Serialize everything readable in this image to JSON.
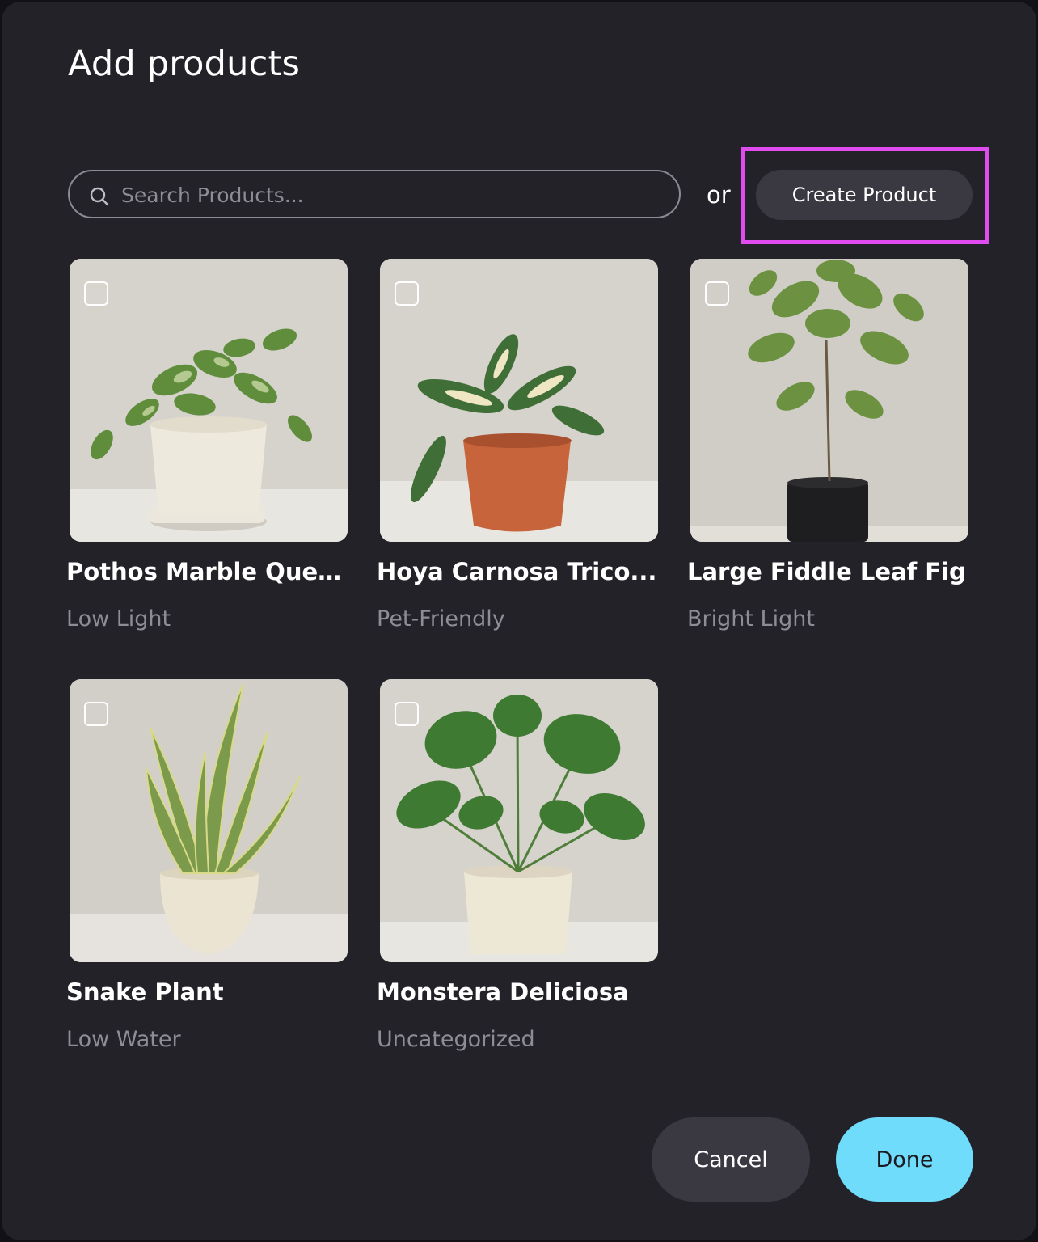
{
  "modal": {
    "title": "Add products"
  },
  "search": {
    "placeholder": "Search Products...",
    "value": "",
    "icon": "search-icon"
  },
  "or_label": "or",
  "create_product_label": "Create Product",
  "colors": {
    "modal_bg": "#232229",
    "highlight": "#e14cf0",
    "done_bg": "#6fdcfb",
    "secondary_button_bg": "#3a3941",
    "muted_text": "#8e8d96"
  },
  "products": [
    {
      "name": "Pothos Marble Queen",
      "category": "Low Light",
      "checked": false,
      "image": "pothos-plant-image"
    },
    {
      "name": "Hoya Carnosa Trico...",
      "category": "Pet-Friendly",
      "checked": false,
      "image": "hoya-plant-image"
    },
    {
      "name": "Large Fiddle Leaf Fig",
      "category": "Bright Light",
      "checked": false,
      "image": "fiddle-leaf-fig-image"
    },
    {
      "name": "Snake Plant",
      "category": "Low Water",
      "checked": false,
      "image": "snake-plant-image"
    },
    {
      "name": "Monstera Deliciosa",
      "category": "Uncategorized",
      "checked": false,
      "image": "monstera-plant-image"
    }
  ],
  "footer": {
    "cancel_label": "Cancel",
    "done_label": "Done"
  }
}
